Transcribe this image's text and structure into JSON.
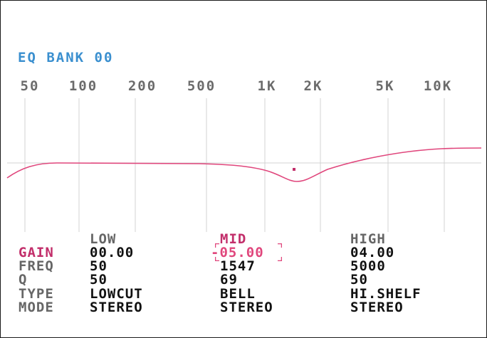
{
  "title": "EQ BANK 00",
  "freq_labels": [
    "50",
    "100",
    "200",
    "500",
    "1K",
    "2K",
    "5K",
    "10K"
  ],
  "colors": {
    "title": "#3a8fcf",
    "accent": "#c22e6a",
    "curve": "#e0467c",
    "grid": "#d3d3d3",
    "label": "#666666",
    "value": "#111111"
  },
  "eq": {
    "selected_band": "MID",
    "selected_param": "GAIN"
  },
  "bands": {
    "low": {
      "name": "LOW",
      "gain": "00.00",
      "freq": "50",
      "q": "50",
      "type": "LOWCUT",
      "mode": "STEREO"
    },
    "mid": {
      "name": "MID",
      "gain": "-05.00",
      "freq": "1547",
      "q": "69",
      "type": "BELL",
      "mode": "STEREO"
    },
    "high": {
      "name": "HIGH",
      "gain": "04.00",
      "freq": "5000",
      "q": "50",
      "type": "HI.SHELF",
      "mode": "STEREO"
    }
  },
  "params": {
    "gain": "GAIN",
    "freq": "FREQ",
    "q": "Q",
    "type": "TYPE",
    "mode": "MODE"
  }
}
